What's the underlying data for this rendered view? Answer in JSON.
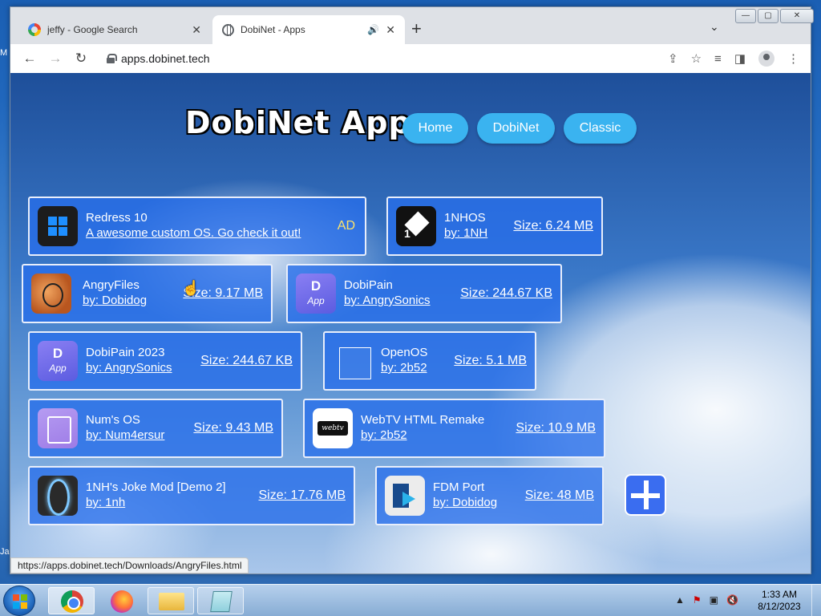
{
  "desktop": {
    "left_labels": [
      "M",
      "Ja"
    ]
  },
  "browser": {
    "tabs": [
      {
        "title": "jeffy - Google Search",
        "icon": "google-icon",
        "close": "✕"
      },
      {
        "title": "DobiNet - Apps",
        "icon": "globe-icon",
        "close": "✕",
        "audio": "🔊"
      }
    ],
    "new_tab": "+",
    "tab_menu": "⌄",
    "window_controls": {
      "minimize": "—",
      "maximize": "▢",
      "close": "✕"
    },
    "url": "apps.dobinet.tech",
    "status_url": "https://apps.dobinet.tech/Downloads/AngryFiles.html"
  },
  "site": {
    "logo": "DobiNet Apps",
    "nav": [
      "Home",
      "DobiNet",
      "Classic"
    ]
  },
  "apps": [
    {
      "name": "Redress 10",
      "subtitle": "A awesome custom OS. Go check it out!",
      "badge": "AD",
      "icon": "windows-logo-icon"
    },
    {
      "name": "1NHOS",
      "subtitle": "by: 1NH",
      "size": "Size: 6.24 MB",
      "icon": "1nhos-icon"
    },
    {
      "name": "AngryFiles",
      "subtitle": "by: Dobidog",
      "size": "Size: 9.17 MB",
      "icon": "angryfiles-icon"
    },
    {
      "name": "DobiPain",
      "subtitle": "by: AngrySonics",
      "size": "Size: 244.67 KB",
      "icon": "dobipain-icon"
    },
    {
      "name": "DobiPain 2023",
      "subtitle": "by: AngrySonics",
      "size": "Size: 244.67 KB",
      "icon": "dobipain-icon"
    },
    {
      "name": "OpenOS",
      "subtitle": "by: 2b52",
      "size": "Size: 5.1 MB",
      "icon": "folder-outline-icon"
    },
    {
      "name": "Num's OS",
      "subtitle": "by: Num4ersur",
      "size": "Size: 9.43 MB",
      "icon": "numos-icon"
    },
    {
      "name": "WebTV HTML Remake",
      "subtitle": "by: 2b52",
      "size": "Size: 10.9 MB",
      "icon": "webtv-icon"
    },
    {
      "name": "1NH's Joke Mod [Demo 2]",
      "subtitle": "by: 1nh",
      "size": "Size: 17.76 MB",
      "icon": "portal-icon"
    },
    {
      "name": "FDM Port",
      "subtitle": "by: Dobidog",
      "size": "Size: 48 MB",
      "icon": "fdm-icon"
    }
  ],
  "taskbar": {
    "items": [
      "start-button",
      "chrome",
      "firefox",
      "explorer",
      "notepad"
    ],
    "clock_time": "1:33 AM",
    "clock_date": "8/12/2023"
  }
}
